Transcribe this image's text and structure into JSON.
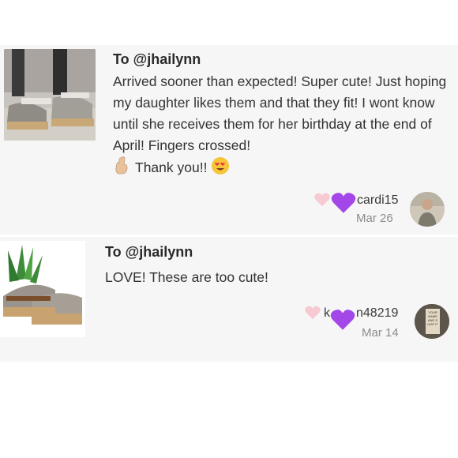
{
  "reviews": [
    {
      "to": "To @jhailynn",
      "message": "Arrived sooner than expected! Super cute! Just hoping my daughter likes them and that they fit! I wont know until she receives them for her birthday at the end of April! Fingers crossed!",
      "thanks": "Thank you!!",
      "username_visible": "cardi15",
      "date": "Mar 26",
      "thumbnail_icon": "sandal-photo-icon",
      "avatar_icon": "user-avatar-icon"
    },
    {
      "to": "To @jhailynn",
      "message": "LOVE! These are too cute!",
      "username_visible": "k",
      "username_visible_tail": "n48219",
      "date": "Mar 14",
      "thumbnail_icon": "sandal-photo-icon",
      "avatar_icon": "user-avatar-icon",
      "avatar_text": "YOUR NAME AND SHOP IT"
    }
  ],
  "colors": {
    "card_bg": "#f6f6f6",
    "heart_pink": "#f7c9d3",
    "heart_purple": "#a347e8",
    "date_gray": "#8c8c8c"
  }
}
